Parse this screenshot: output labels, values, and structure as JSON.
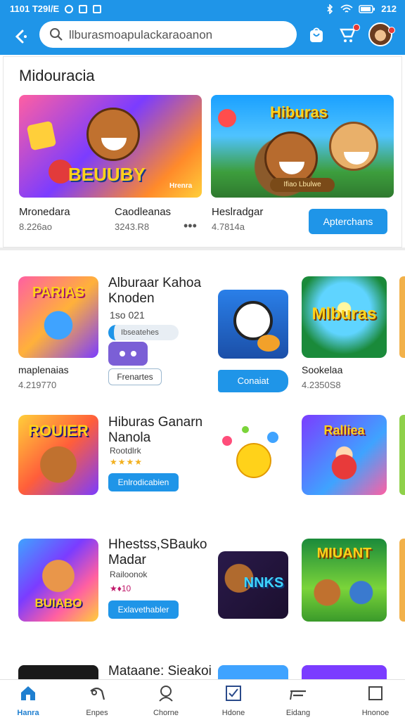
{
  "status_bar": {
    "time": "1101 T29l/E",
    "battery": "212"
  },
  "search": {
    "value": "llburasmoapulackaraoanon"
  },
  "section1": {
    "title": "Midouracia",
    "banners": [
      {
        "label": "BEUUBY",
        "badge": "Hrenra"
      },
      {
        "label": "Hiburas",
        "tag": "Ifiao Lbulwe"
      }
    ],
    "items": [
      {
        "name": "Mronedara",
        "sub": "8.226ao"
      },
      {
        "name": "Caodleanas",
        "sub": "3243.R8"
      },
      {
        "name": "Heslradgar",
        "sub": "4.7814a"
      }
    ],
    "action_button": "Apterchans"
  },
  "rows": [
    {
      "left_tile_text": "PARIAS",
      "title_line1": "Alburaar Kahoa",
      "title_line2": "Knoden",
      "sub": "1so 021",
      "chip": "Ibseatehes",
      "outline_button": "Frenartes",
      "under_left_name": "maplenaias",
      "under_left_sub": "4.219770",
      "mid_button": "Conaiat",
      "right_tile_text": "Mlburas",
      "right_name": "Sookelaa",
      "right_sub": "4.2350S8"
    },
    {
      "left_tile_text": "ROUIER",
      "title_line1": "Hiburas Ganarn",
      "title_line2": "Nanola",
      "sub": "Rootdlrk",
      "stars": "★★★★",
      "button": "Enlrodicabien",
      "right_tile_text": "Ralliea"
    },
    {
      "left_tile_text": "BUIABO",
      "title_line1": "Hhestss,SBauko",
      "title_line2": "Madar",
      "sub": "Railoonok",
      "rating": "★♦10",
      "button": "Exlavethabler",
      "mid_tile_text": "NNKS",
      "right_tile_text": "MIUANT"
    },
    {
      "title_line1": "Mataane: Sieakoi"
    }
  ],
  "bottom_nav": [
    {
      "label": "Hanra"
    },
    {
      "label": "Enpes"
    },
    {
      "label": "Chorne"
    },
    {
      "label": "Hdone"
    },
    {
      "label": "Eidang"
    },
    {
      "label": "Hnonoe"
    }
  ],
  "colors": {
    "brand": "#1f95e8",
    "accent_blue": "#1f7fd0"
  }
}
